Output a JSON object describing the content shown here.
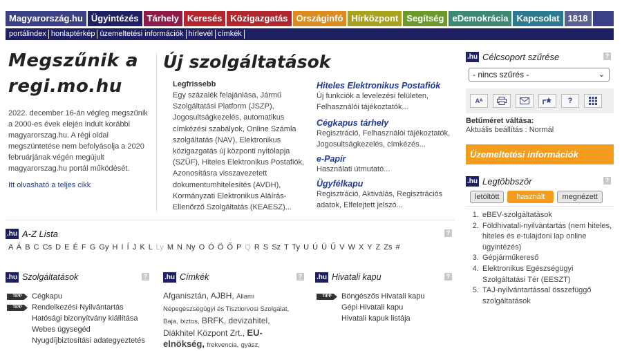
{
  "topnav": [
    {
      "label": "Magyarország.hu",
      "color": "#3a3f86"
    },
    {
      "label": "Ügyintézés",
      "color": "#1f2063"
    },
    {
      "label": "Tárhely",
      "color": "#8e1a4a"
    },
    {
      "label": "Keresés",
      "color": "#b3262e"
    },
    {
      "label": "Közigazgatás",
      "color": "#b3262e"
    },
    {
      "label": "Országinfó",
      "color": "#dc8b1d"
    },
    {
      "label": "Hírközpont",
      "color": "#a9a31c"
    },
    {
      "label": "Segítség",
      "color": "#6b9a2b"
    },
    {
      "label": "eDemokrácia",
      "color": "#3c8a73"
    },
    {
      "label": "Kapcsolat",
      "color": "#2c7a8f"
    },
    {
      "label": "1818",
      "color": "#5b6090"
    }
  ],
  "subnav": [
    "portálindex",
    "honlaptérkép",
    "üzemeltetési információk",
    "hírlevél",
    "címkék"
  ],
  "feature": {
    "title": "Megszűnik a regi.mo.hu",
    "body": "2022. december 16-án végleg megszűnik a 2000-es évek elején indult korábbi magyarorszag.hu. A régi oldal megszüntetése nem befolyásolja a 2020 februárjának végén megújult magyarorszag.hu portál működését.",
    "more": "Itt olvasható a teljes cikk"
  },
  "new_services": {
    "title": "Új szolgáltatások",
    "latest_label": "Legfrissebb",
    "latest_text": "Egy százalék felajánlása, Jármű Szolgáltatási Platform (JSZP), Jogosultságkezelés, automatikus címkézési szabályok, Online Számla szolgáltatás (NAV), Elektronikus közigazgatás új központi nyitólapja (SZÜF), Hiteles Elektronikus Postafiók, Azonosításra visszavezetett dokumentumhitelesítés (AVDH), Kormányzati Elektronikus Aláírás-Ellenőrző Szolgáltatás (KEAESZ)...",
    "items": [
      {
        "title": "Hiteles Elektronikus Postafiók",
        "desc": "Új funkciók a levelezési felületen, Felhasználói tájékoztatók..."
      },
      {
        "title": "Cégkapus tárhely",
        "desc": "Regisztráció, Felhasználói tájékoztatók, Jogosultságkezelés, címkézés..."
      },
      {
        "title": "e-Papír",
        "desc": "Használati útmutató..."
      },
      {
        "title": "Ügyfélkapu",
        "desc": "Regisztráció, Aktiválás, Regisztrációs adatok, Elfelejtett jelszó..."
      }
    ]
  },
  "sidebar": {
    "filter_title": "Célcsoport szűrése",
    "filter_value": "- nincs szűrés -",
    "font_label": "Betűméret váltása:",
    "font_current": "Aktuális beállítás : Normál",
    "ops": "Üzemeltetési információk",
    "most_title": "Legtöbbször",
    "tabs": [
      "letöltött",
      "használt",
      "megnézett"
    ],
    "most_list": [
      "eBEV-szolgáltatások",
      "Földhivatali-nyilvántartás (nem hiteles, hiteles és e-tulajdoni lap online ügyintézés)",
      "Gépjárműkereső",
      "Elektronikus Egészségügyi Szolgáltatási Tér (EESZT)",
      "TAJ-nyilvántartással összefüggő szolgáltatások"
    ]
  },
  "az": {
    "title": "A-Z Lista",
    "letters": [
      "A",
      "Á",
      "B",
      "C",
      "Cs",
      "D",
      "E",
      "É",
      "F",
      "G",
      "Gy",
      "H",
      "I",
      "Í",
      "J",
      "K",
      "L",
      "Ly",
      "M",
      "N",
      "Ny",
      "O",
      "Ó",
      "Ö",
      "Ő",
      "P",
      "Q",
      "R",
      "S",
      "Sz",
      "T",
      "Ty",
      "U",
      "Ú",
      "Ü",
      "Ű",
      "V",
      "W",
      "X",
      "Y",
      "Z",
      "Zs",
      "#"
    ],
    "disabled": [
      "Ly",
      "Q"
    ]
  },
  "boxes": {
    "services": {
      "title": "Szolgáltatások",
      "items": [
        {
          "label": "Cégkapu",
          "tipp": true
        },
        {
          "label": "Rendelkezési Nyilvántartás",
          "tipp": true
        },
        {
          "label": "Hatósági bizonyítvány kiállítása",
          "tipp": false
        },
        {
          "label": "Webes ügysegéd",
          "tipp": false
        },
        {
          "label": "Nyugdíjbiztosítási adategyeztetés",
          "tipp": false
        }
      ]
    },
    "tags": {
      "title": "Címkék",
      "items": [
        {
          "t": "Afganisztán,",
          "s": "m"
        },
        {
          "t": "AJBH,",
          "s": "m"
        },
        {
          "t": "Állami Népegészségügyi és Tisztiorvosi Szolgálat,",
          "s": "s"
        },
        {
          "t": "Baja,",
          "s": "s"
        },
        {
          "t": "biztos,",
          "s": "s"
        },
        {
          "t": "BRFK,",
          "s": "m"
        },
        {
          "t": "devizahitel,",
          "s": "m"
        },
        {
          "t": "Diákhitel Központ Zrt.,",
          "s": "m"
        },
        {
          "t": "EU-elnökség,",
          "s": "b"
        },
        {
          "t": "frekvencia,",
          "s": "s"
        },
        {
          "t": "gyász,",
          "s": "s"
        }
      ]
    },
    "office": {
      "title": "Hivatali kapu",
      "items": [
        {
          "label": "Böngészős Hivatali kapu",
          "tipp": true
        },
        {
          "label": "Gépi Hivatali kapu",
          "tipp": false
        },
        {
          "label": "Hivatali kapuk listája",
          "tipp": false
        }
      ]
    },
    "tipp_label": "TIPP",
    "hu_badge": ".hu"
  },
  "help_glyph": "?",
  "tool_font_glyph": "Aᴬ"
}
